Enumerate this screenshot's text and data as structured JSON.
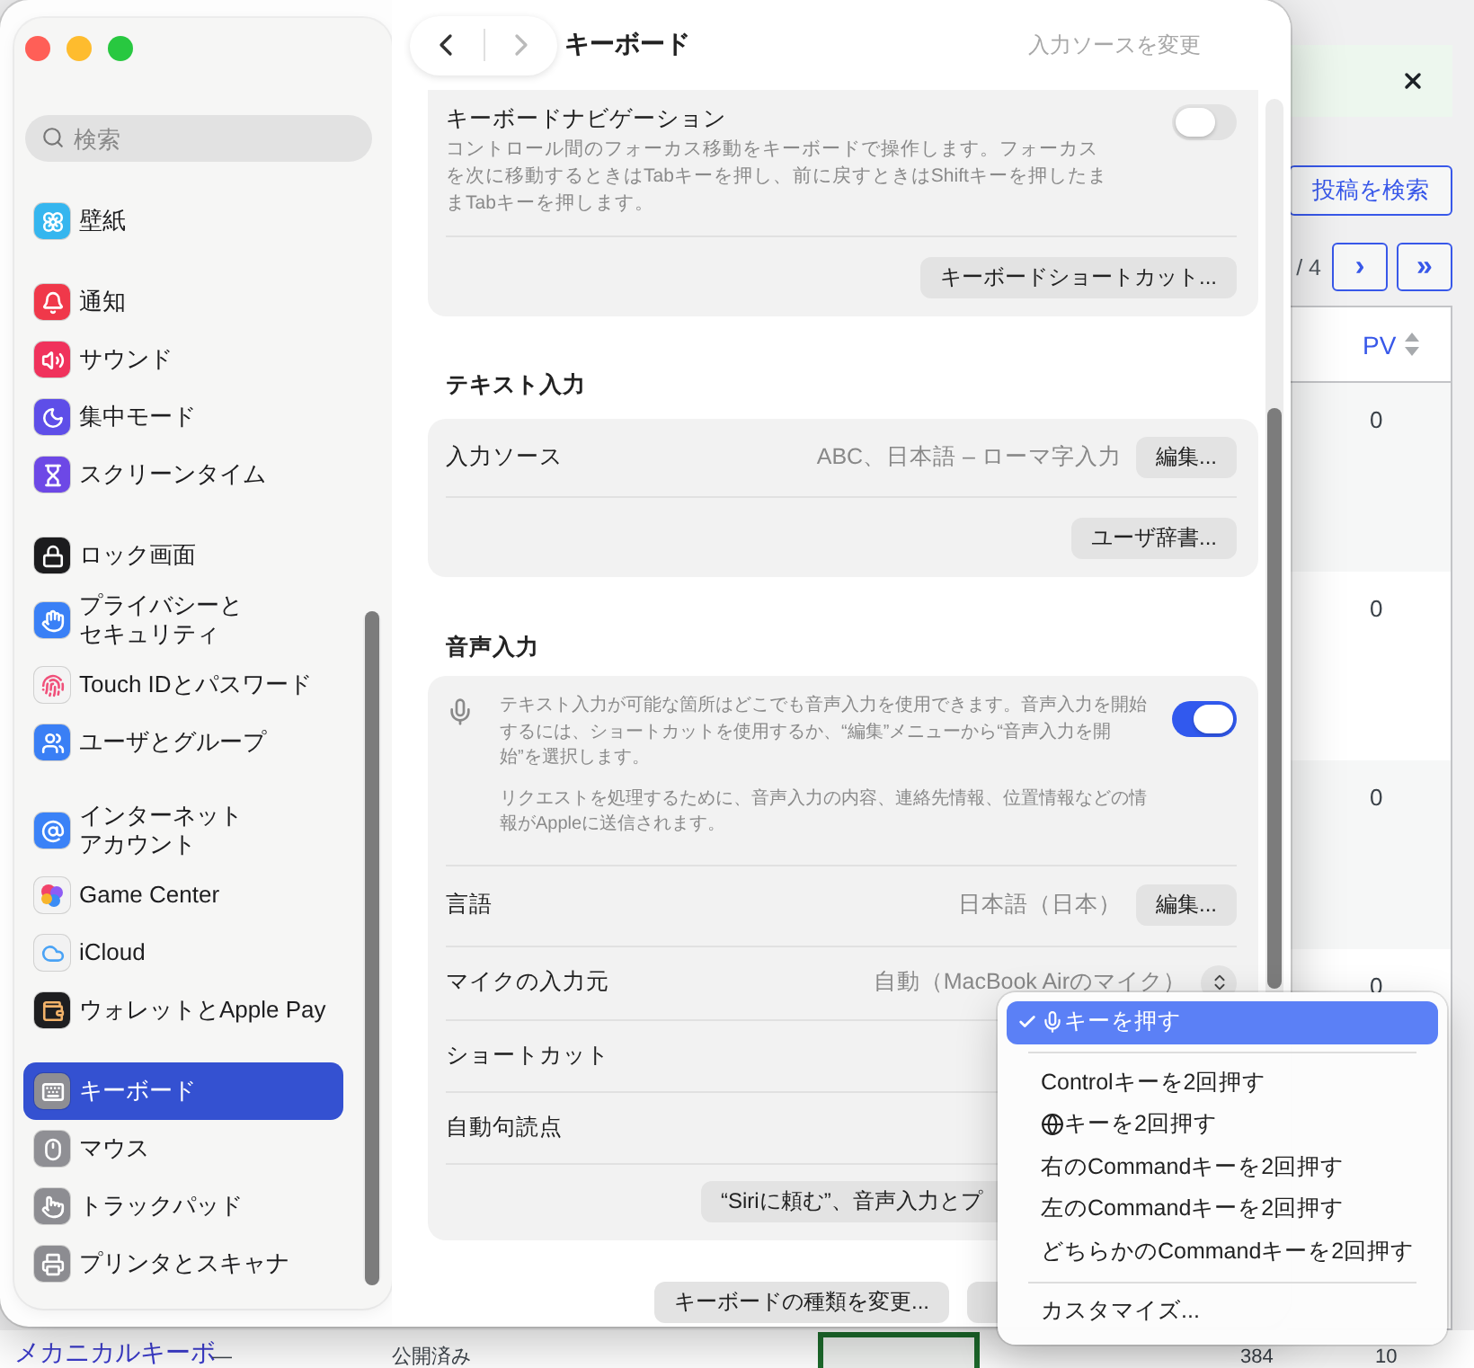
{
  "background_page": {
    "search_button": "投稿を検索",
    "pagination": {
      "page_text": "/ 4",
      "next": "›",
      "last": "»"
    },
    "table": {
      "columns": [
        {
          "label": "PV"
        }
      ],
      "rows": [
        {
          "pv": "0"
        },
        {
          "pv": "0"
        },
        {
          "pv": "0"
        },
        {
          "pv": "0"
        }
      ]
    },
    "bottom_row": {
      "title": "メカニカルキーボ",
      "author": "—",
      "status": "公開済み",
      "column_4": "384",
      "pv": "10"
    }
  },
  "window": {
    "title": "キーボード",
    "toolbar_hint": "入力ソースを変更"
  },
  "sidebar": {
    "search": {
      "placeholder": "検索"
    },
    "groups": [
      {
        "items": [
          {
            "label": "壁紙",
            "color": "#35b6ef",
            "selected": false
          }
        ]
      },
      {
        "items": [
          {
            "label": "通知",
            "color": "#f0384a",
            "selected": false
          },
          {
            "label": "サウンド",
            "color": "#f0325c",
            "selected": false
          },
          {
            "label": "集中モード",
            "color": "#5e4ee8",
            "selected": false
          },
          {
            "label": "スクリーンタイム",
            "color": "#6d48e6",
            "selected": false
          }
        ]
      },
      {
        "items": [
          {
            "label": "ロック画面",
            "color": "#1c1c1e",
            "selected": false
          },
          {
            "label": "プライバシーとセキュリティ",
            "color": "#3a80f6",
            "selected": false
          },
          {
            "label": "Touch IDとパスワード",
            "color": "#f4f4f4",
            "selected": false
          },
          {
            "label": "ユーザとグループ",
            "color": "#3a7ff5",
            "selected": false
          }
        ]
      },
      {
        "items": [
          {
            "label": "インターネットアカウント",
            "color": "#3b82f7",
            "selected": false
          },
          {
            "label": "Game Center",
            "color": "#f3f3f3",
            "selected": false
          },
          {
            "label": "iCloud",
            "color": "#f2f2f2",
            "selected": false
          },
          {
            "label": "ウォレットとApple Pay",
            "color": "#1e1e20",
            "selected": false
          }
        ]
      },
      {
        "items": [
          {
            "label": "キーボード",
            "color": "#8e8e93",
            "selected": true
          },
          {
            "label": "マウス",
            "color": "#8f8f94",
            "selected": false
          },
          {
            "label": "トラックパッド",
            "color": "#8d8d92",
            "selected": false
          },
          {
            "label": "プリンタとスキャナ",
            "color": "#8c8c91",
            "selected": false
          }
        ]
      }
    ]
  },
  "sections": [
    {
      "rows": [
        {
          "kind": "info",
          "title": "キーボードナビゲーション",
          "paragraphs": [
            "コントロール間のフォーカス移動をキーボードで操作します。フォーカスを次に移動するときはTabキーを押し、前に戻すときはShiftキーを押したままTabキーを押します。"
          ],
          "on": false
        },
        {
          "kind": "button",
          "button": "キーボードショートカット..."
        }
      ]
    },
    {
      "heading": "テキスト入力",
      "rows": [
        {
          "kind": "value_button",
          "label": "入力ソース",
          "value": "ABC、日本語 – ローマ字入力",
          "button": "編集..."
        },
        {
          "kind": "button",
          "button": "ユーザ辞書..."
        }
      ]
    },
    {
      "heading": "音声入力",
      "rows": [
        {
          "kind": "mic_info",
          "paragraphs": [
            "テキスト入力が可能な箇所はどこでも音声入力を使用できます。音声入力を開始するには、ショートカットを使用するか、“編集”メニューから“音声入力を開始”を選択します。",
            "リクエストを処理するために、音声入力の内容、連絡先情報、位置情報などの情報がAppleに送信されます。"
          ],
          "on": true
        },
        {
          "kind": "value_button",
          "label": "言語",
          "value": "日本語（日本）",
          "button": "編集..."
        },
        {
          "kind": "stepper",
          "label": "マイクの入力元",
          "value": "自動（MacBook Airのマイク）"
        },
        {
          "kind": "label",
          "label": "ショートカット"
        },
        {
          "kind": "label",
          "label": "自動句読点"
        },
        {
          "kind": "wide_button",
          "button": "“Siriに頼む”、音声入力とプ"
        }
      ]
    }
  ],
  "footer_buttons": [
    {
      "kind": "labeled",
      "label": "キーボードの種類を変更..."
    },
    {
      "kind": "covered"
    }
  ],
  "shortcut_menu": {
    "items": [
      {
        "kind": "mic_key",
        "label": "キーを押す",
        "selected": true
      },
      {
        "kind": "separator"
      },
      {
        "kind": "option",
        "label": "Controlキーを2回押す",
        "selected": false
      },
      {
        "kind": "globe_key",
        "label": "キーを2回押す",
        "selected": false
      },
      {
        "kind": "option",
        "label": "右のCommandキーを2回押す",
        "selected": false
      },
      {
        "kind": "option",
        "label": "左のCommandキーを2回押す",
        "selected": false
      },
      {
        "kind": "option",
        "label": "どちらかのCommandキーを2回押す",
        "selected": false
      },
      {
        "kind": "separator"
      },
      {
        "kind": "option",
        "label": "カスタマイズ...",
        "selected": false
      }
    ]
  }
}
